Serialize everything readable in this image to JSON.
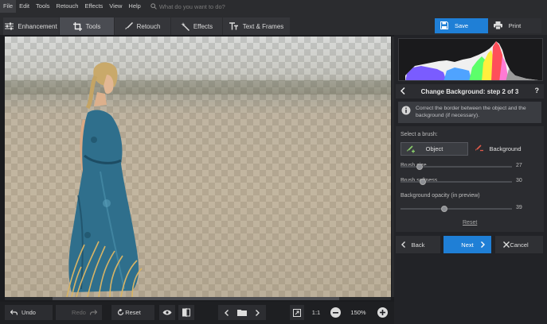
{
  "menu": [
    {
      "label": "File",
      "active": true
    },
    {
      "label": "Edit"
    },
    {
      "label": "Tools"
    },
    {
      "label": "Retouch"
    },
    {
      "label": "Effects"
    },
    {
      "label": "View"
    },
    {
      "label": "Help"
    }
  ],
  "search": {
    "placeholder": "What do you want to do?",
    "icon": "search-icon"
  },
  "tabs": [
    {
      "label": "Enhancement",
      "icon": "sliders-icon"
    },
    {
      "label": "Tools",
      "icon": "crop-icon",
      "active": true
    },
    {
      "label": "Retouch",
      "icon": "brush-icon"
    },
    {
      "label": "Effects",
      "icon": "magic-wand-icon"
    },
    {
      "label": "Text & Frames",
      "icon": "text-icon"
    }
  ],
  "actions": {
    "save": "Save",
    "print": "Print"
  },
  "panel": {
    "step_title": "Change Background: step 2 of 3",
    "help": "?",
    "hint": "Correct the border between the object and the background (if necessary).",
    "select_brush": "Select a brush:",
    "brush_object": "Object",
    "brush_background": "Background",
    "brush_size_label": "Brush size",
    "brush_size": 27,
    "brush_softness_label": "Brush softness",
    "brush_softness": 30,
    "bg_opacity_label": "Background opacity (in preview)",
    "bg_opacity": 39,
    "reset": "Reset",
    "back": "Back",
    "next": "Next",
    "cancel": "Cancel"
  },
  "bottombar": {
    "undo": "Undo",
    "redo": "Redo",
    "reset": "Reset",
    "actual_size": "1:1",
    "zoom": "150%"
  },
  "colors": {
    "accent": "#1f7fd6",
    "panel": "#2b2c30",
    "background": "#1e1f22"
  }
}
